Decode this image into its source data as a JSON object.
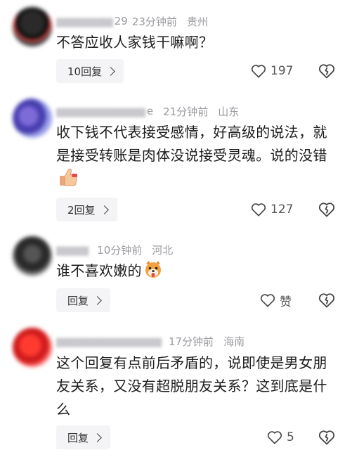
{
  "comments": [
    {
      "name": "29",
      "time": "23分钟前",
      "region": "贵州",
      "text": "不答应收人家钱干嘛啊？",
      "reply_label": "10回复",
      "likes": "197",
      "emoji": ""
    },
    {
      "name": "e",
      "time": "21分钟前",
      "region": "山东",
      "text": "收下钱不代表接受感情，好高级的说法，就是接受转账是肉体没说接受灵魂。说的没错",
      "reply_label": "2回复",
      "likes": "127",
      "emoji": "thumbs-up"
    },
    {
      "name": "",
      "time": "10分钟前",
      "region": "河北",
      "text": "谁不喜欢嫩的",
      "reply_label": "回复",
      "likes": "赞",
      "emoji": "dog-face-tongue"
    },
    {
      "name": "",
      "time": "17分钟前",
      "region": "海南",
      "text": "这个回复有点前后矛盾的，说即使是男女朋友关系，又没有超脱朋友关系？这到底是什么",
      "reply_label": "回复",
      "likes": "5",
      "emoji": ""
    }
  ],
  "icons": {
    "like": "heart-outline-icon",
    "dislike": "broken-heart-icon",
    "reply_chevron": "chevron-right-icon"
  },
  "colors": {
    "meta_text": "#9a9aa0",
    "button_bg": "#f4f4f6",
    "body_text": "#1c1c1c"
  }
}
